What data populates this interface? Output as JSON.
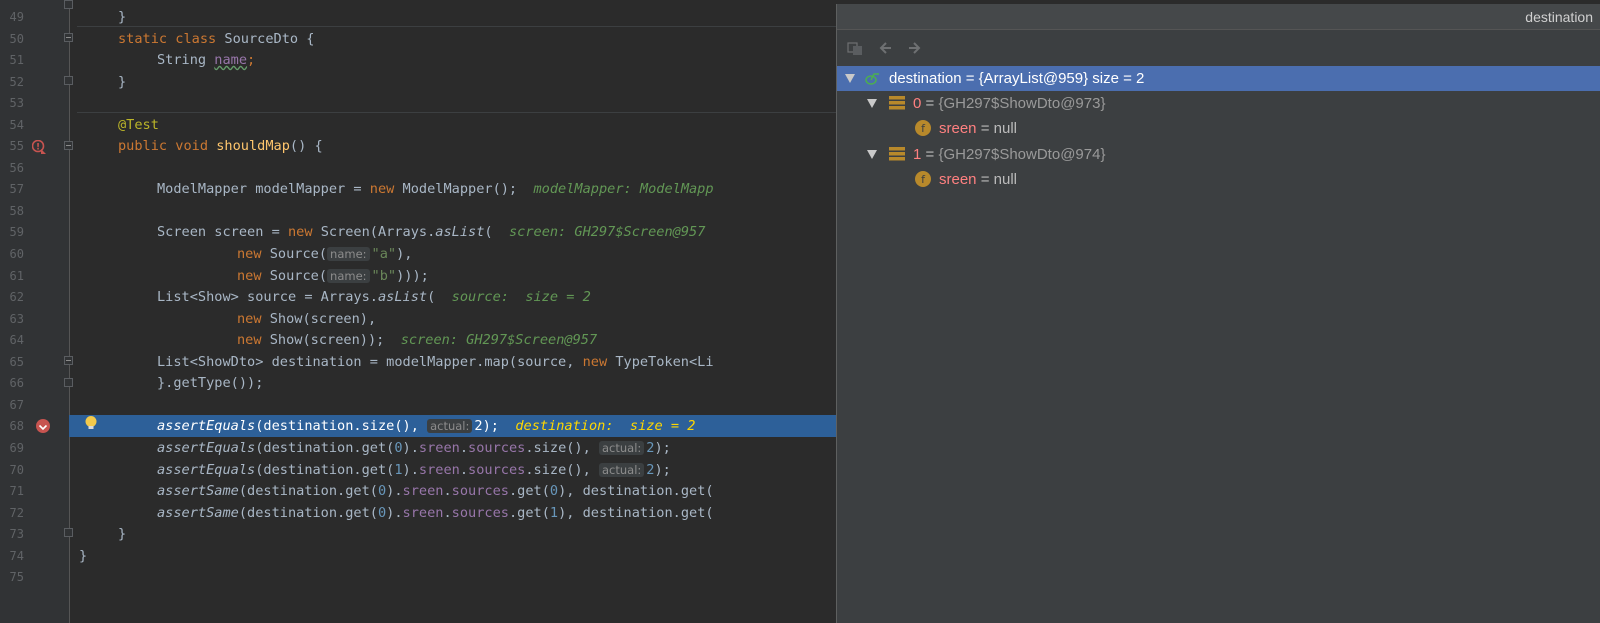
{
  "editor": {
    "line_numbers": [
      "49",
      "50",
      "51",
      "52",
      "53",
      "54",
      "55",
      "56",
      "57",
      "58",
      "59",
      "60",
      "61",
      "62",
      "63",
      "64",
      "65",
      "66",
      "67",
      "68",
      "69",
      "70",
      "71",
      "72",
      "73",
      "74",
      "75"
    ],
    "code": {
      "l49": "}",
      "l50": {
        "kw1": "static",
        "kw2": "class",
        "name": "SourceDto",
        "rest": " {"
      },
      "l51": {
        "type": "String",
        "field": "name",
        "semi": ";"
      },
      "l52": "}",
      "l54": "@Test",
      "l55": {
        "kw1": "public",
        "kw2": "void",
        "method": "shouldMap",
        "rest": "() {"
      },
      "l57": {
        "a": "ModelMapper modelMapper = ",
        "kw": "new",
        "b": " ModelMapper();",
        "comment": "modelMapper: ModelMapp"
      },
      "l59": {
        "a": "Screen screen = ",
        "kw": "new",
        "b": " Screen(Arrays.",
        "it": "asList",
        "c": "(",
        "comment": "screen: GH297$Screen@957"
      },
      "l60": {
        "kw": "new",
        "b": " Source(",
        "hint": "name:",
        "str": "\"a\"",
        "c": "),"
      },
      "l61": {
        "kw": "new",
        "b": " Source(",
        "hint": "name:",
        "str": "\"b\"",
        "c": ")));"
      },
      "l62": {
        "a": "List<Show> source = Arrays.",
        "it": "asList",
        "c": "(",
        "comment": "source:  size = 2"
      },
      "l63": {
        "kw": "new",
        "b": " Show(screen),"
      },
      "l64": {
        "kw": "new",
        "b": " Show(screen));",
        "comment": "screen: GH297$Screen@957"
      },
      "l65": {
        "a": "List<ShowDto> destination = modelMapper.map(source, ",
        "kw": "new",
        "b": " TypeToken<Li"
      },
      "l66": "}.getType());",
      "l68": {
        "it": "assertEquals",
        "a": "(destination.size(), ",
        "hint": "actual:",
        "num": "2",
        "b": ");",
        "comment": "destination:  size = 2"
      },
      "l69": {
        "it": "assertEquals",
        "a": "(destination.get(",
        "n0": "0",
        "b": ").",
        "f1": "sreen",
        "c": ".",
        "f2": "sources",
        "d": ".size(), ",
        "hint": "actual:",
        "num": "2",
        "e": ");"
      },
      "l70": {
        "it": "assertEquals",
        "a": "(destination.get(",
        "n0": "1",
        "b": ").",
        "f1": "sreen",
        "c": ".",
        "f2": "sources",
        "d": ".size(), ",
        "hint": "actual:",
        "num": "2",
        "e": ");"
      },
      "l71": {
        "it": "assertSame",
        "a": "(destination.get(",
        "n0": "0",
        "b": ").",
        "f1": "sreen",
        "c": ".",
        "f2": "sources",
        "d": ".get(",
        "n1": "0",
        "e": "), destination.get("
      },
      "l72": {
        "it": "assertSame",
        "a": "(destination.get(",
        "n0": "0",
        "b": ").",
        "f1": "sreen",
        "c": ".",
        "f2": "sources",
        "d": ".get(",
        "n1": "1",
        "e": "), destination.get("
      },
      "l73": "}",
      "l74": "}"
    }
  },
  "popup": {
    "title": "destination",
    "toolbar": {
      "icons": [
        "collapse-icon",
        "back-arrow-icon",
        "forward-arrow-icon"
      ]
    },
    "tree": [
      {
        "name": "destination",
        "eq": " = ",
        "value": "{ArrayList@959}",
        "extra": "  size = 2",
        "icon": "watch-icon"
      },
      {
        "name": "0",
        "eq": " = ",
        "value": "{GH297$ShowDto@973}",
        "icon": "object-icon"
      },
      {
        "name": "sreen",
        "eq": " = ",
        "value": "null",
        "icon": "field-icon",
        "letter": "f"
      },
      {
        "name": "1",
        "eq": " = ",
        "value": "{GH297$ShowDto@974}",
        "icon": "object-icon"
      },
      {
        "name": "sreen",
        "eq": " = ",
        "value": "null",
        "icon": "field-icon",
        "letter": "f"
      }
    ]
  },
  "colors": {
    "selection": "#4b6eaf",
    "exec_line": "#2d6099",
    "keyword": "#cc7832",
    "annotation": "#bbb529",
    "method": "#ffc66d",
    "field": "#9876aa",
    "string": "#6a8759",
    "number": "#6897bb",
    "comment": "#629755"
  }
}
